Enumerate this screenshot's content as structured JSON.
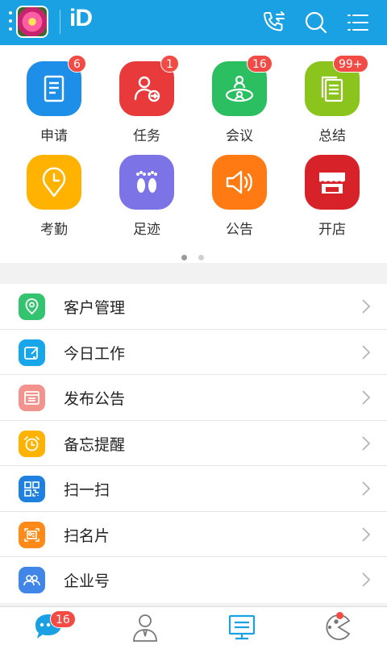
{
  "header": {
    "logo_text": "iD",
    "colors": {
      "bar": "#19a1e3"
    }
  },
  "grid": {
    "items": [
      {
        "label": "申请",
        "badge": "6",
        "icon": "document-icon",
        "color": "#1d8fe8"
      },
      {
        "label": "任务",
        "badge": "1",
        "icon": "person-arrow-icon",
        "color": "#e83a3a"
      },
      {
        "label": "会议",
        "badge": "16",
        "icon": "meeting-icon",
        "color": "#2cbf62"
      },
      {
        "label": "总结",
        "badge": "99+",
        "icon": "stack-docs-icon",
        "color": "#8ac41d"
      },
      {
        "label": "考勤",
        "badge": "",
        "icon": "clock-pin-icon",
        "color": "#ffb300"
      },
      {
        "label": "足迹",
        "badge": "",
        "icon": "footprints-icon",
        "color": "#7b73e6"
      },
      {
        "label": "公告",
        "badge": "",
        "icon": "speaker-icon",
        "color": "#ff7a12"
      },
      {
        "label": "开店",
        "badge": "",
        "icon": "store-icon",
        "color": "#d8222a"
      }
    ],
    "pager": {
      "count": 2,
      "active": 0
    }
  },
  "list": {
    "items": [
      {
        "label": "客户管理",
        "icon": "location-pin-icon",
        "color": "#34c36f"
      },
      {
        "label": "今日工作",
        "icon": "edit-icon",
        "color": "#17a6ea"
      },
      {
        "label": "发布公告",
        "icon": "browser-icon",
        "color": "#f2938e"
      },
      {
        "label": "备忘提醒",
        "icon": "alarm-icon",
        "color": "#ffb300"
      },
      {
        "label": "扫一扫",
        "icon": "qr-code-icon",
        "color": "#1f80e0"
      },
      {
        "label": "扫名片",
        "icon": "card-icon",
        "color": "#ff8a18"
      },
      {
        "label": "企业号",
        "icon": "group-icon",
        "color": "#3f86e8"
      }
    ]
  },
  "bottom_bar": {
    "tabs": [
      {
        "name": "messages",
        "icon": "chat-bubble-icon",
        "badge": "16"
      },
      {
        "name": "contacts",
        "icon": "contacts-icon",
        "badge": ""
      },
      {
        "name": "workbench",
        "icon": "monitor-icon",
        "badge": ""
      },
      {
        "name": "games",
        "icon": "pacman-icon",
        "badge": "dot"
      }
    ],
    "active_color": "#19a1e3"
  }
}
